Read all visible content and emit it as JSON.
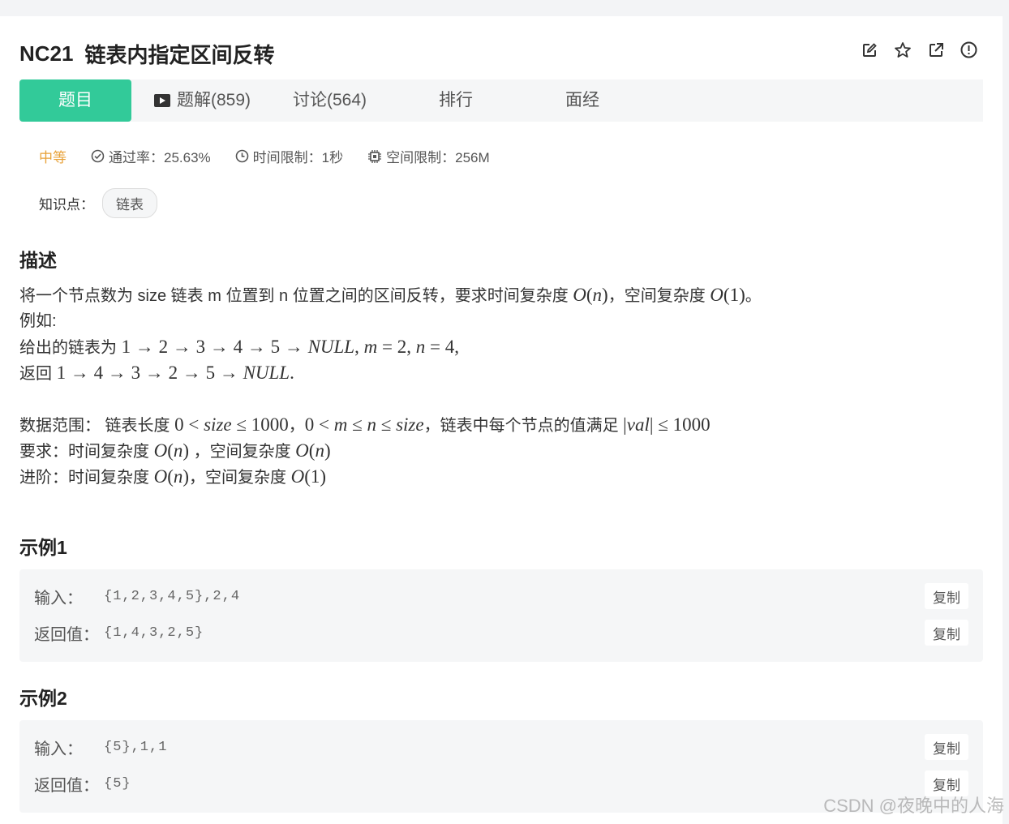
{
  "problem": {
    "code": "NC21",
    "title": "链表内指定区间反转"
  },
  "header_icons": [
    "edit-icon",
    "star-icon",
    "open-external-icon",
    "report-icon"
  ],
  "tabs": {
    "problem": "题目",
    "solutions": "题解(859)",
    "discuss": "讨论(564)",
    "rank": "排行",
    "interview": "面经"
  },
  "meta": {
    "difficulty": "中等",
    "pass_rate": "通过率：25.63%",
    "time_limit": "时间限制：1秒",
    "space_limit": "空间限制：256M"
  },
  "knowledge": {
    "label": "知识点：",
    "tags": [
      "链表"
    ]
  },
  "description": {
    "heading": "描述",
    "l1_a": "将一个节点数为 size 链表 m 位置到 n 位置之间的区间反转，要求时间复杂度 ",
    "l1_b": "，空间复杂度 ",
    "l1_c": "。",
    "l2": "例如:",
    "l3_a": "给出的链表为 ",
    "l4_a": "返回 ",
    "range_a": "数据范围： 链表长度 ",
    "range_b": "，",
    "range_c": "，链表中每个节点的值满足 ",
    "req_a": "要求：时间复杂度 ",
    "req_b": " ，空间复杂度 ",
    "adv_a": "进阶：时间复杂度 ",
    "adv_b": "，空间复杂度 "
  },
  "examples": [
    {
      "heading": "示例1",
      "input_label": "输入：",
      "input_value": "{1,2,3,4,5},2,4",
      "output_label": "返回值：",
      "output_value": "{1,4,3,2,5}",
      "copy_label": "复制"
    },
    {
      "heading": "示例2",
      "input_label": "输入：",
      "input_value": "{5},1,1",
      "output_label": "返回值：",
      "output_value": "{5}",
      "copy_label": "复制"
    }
  ],
  "watermark": "CSDN @夜晚中的人海",
  "colors": {
    "accent": "#32ca99",
    "difficulty": "#e8a23a"
  }
}
